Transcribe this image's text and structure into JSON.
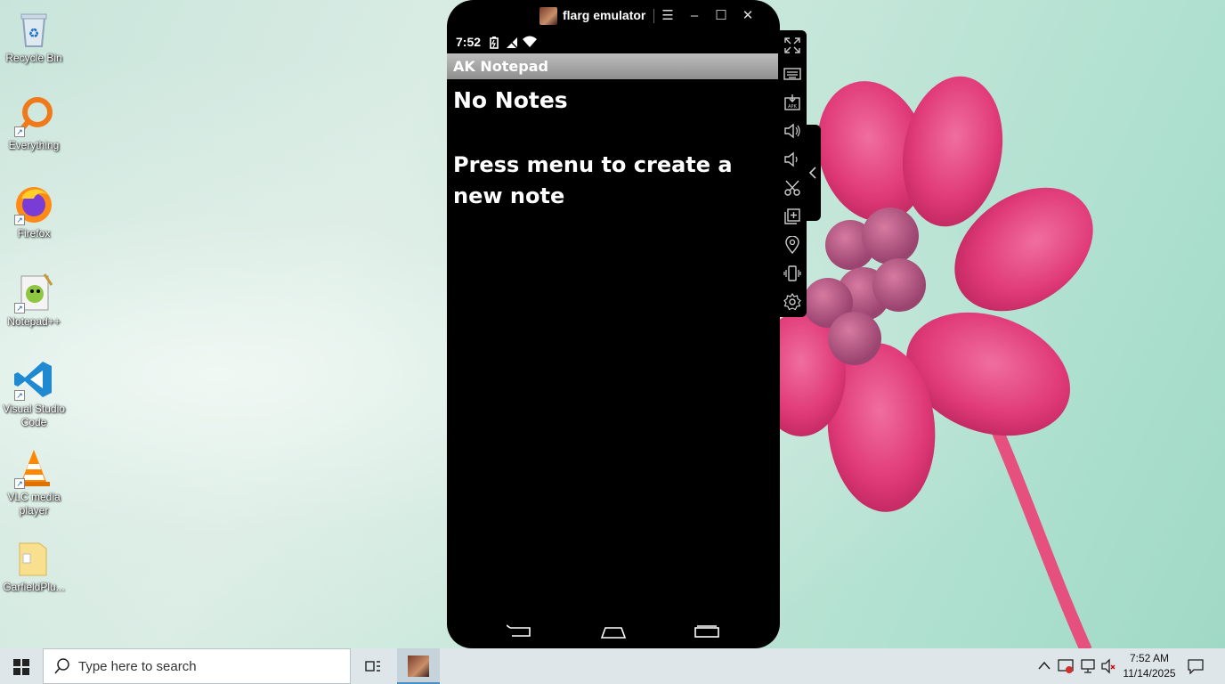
{
  "desktop": {
    "icons": [
      {
        "label": "Recycle Bin",
        "icon": "recycle-bin-icon"
      },
      {
        "label": "Everything",
        "icon": "everything-search-icon"
      },
      {
        "label": "Firefox",
        "icon": "firefox-icon"
      },
      {
        "label": "Notepad++",
        "icon": "notepad-plus-plus-icon"
      },
      {
        "label": "Visual Studio Code",
        "icon": "vscode-icon"
      },
      {
        "label": "VLC media player",
        "icon": "vlc-icon"
      },
      {
        "label": "GarfieldPlu...",
        "icon": "folder-icon"
      }
    ]
  },
  "emulator": {
    "title": "flarg emulator",
    "status_time": "7:52",
    "app_title": "AK Notepad",
    "heading": "No Notes",
    "message": "Press menu to create a new note",
    "toolbar": [
      "fullscreen-icon",
      "keyboard-icon",
      "apk-install-icon",
      "volume-up-icon",
      "volume-down-icon",
      "screenshot-scissors-icon",
      "multi-instance-icon",
      "location-icon",
      "shake-icon",
      "settings-icon"
    ]
  },
  "taskbar": {
    "search_placeholder": "Type here to search",
    "time": "7:52 AM",
    "date": "11/14/2025"
  },
  "colors": {
    "appbar": "#9e9e9e",
    "taskbar": "#dfe6ea",
    "flower": "#e0407a"
  }
}
